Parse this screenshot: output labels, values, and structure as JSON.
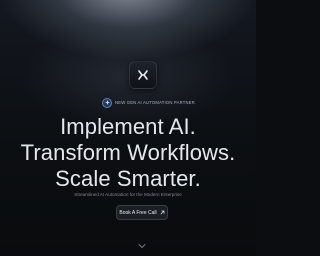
{
  "logo": {
    "icon": "x-logo-icon"
  },
  "badge": {
    "icon": "spark-icon",
    "text": "NEW GEN AI AUTOMATION PARTNER"
  },
  "hero": {
    "line1": "Implement AI.",
    "line2": "Transform Workflows.",
    "line3": "Scale Smarter.",
    "subtitle": "Streamlined AI Automation for the Modern Enterprise"
  },
  "cta": {
    "label": "Book A Free Call",
    "icon": "arrow-up-right-icon"
  },
  "scroll": {
    "icon": "chevron-down-icon"
  },
  "colors": {
    "background": "#0b0d10",
    "text": "#e4e8ee",
    "muted": "#7f8894",
    "badge_accent": "#5a7fc0"
  }
}
